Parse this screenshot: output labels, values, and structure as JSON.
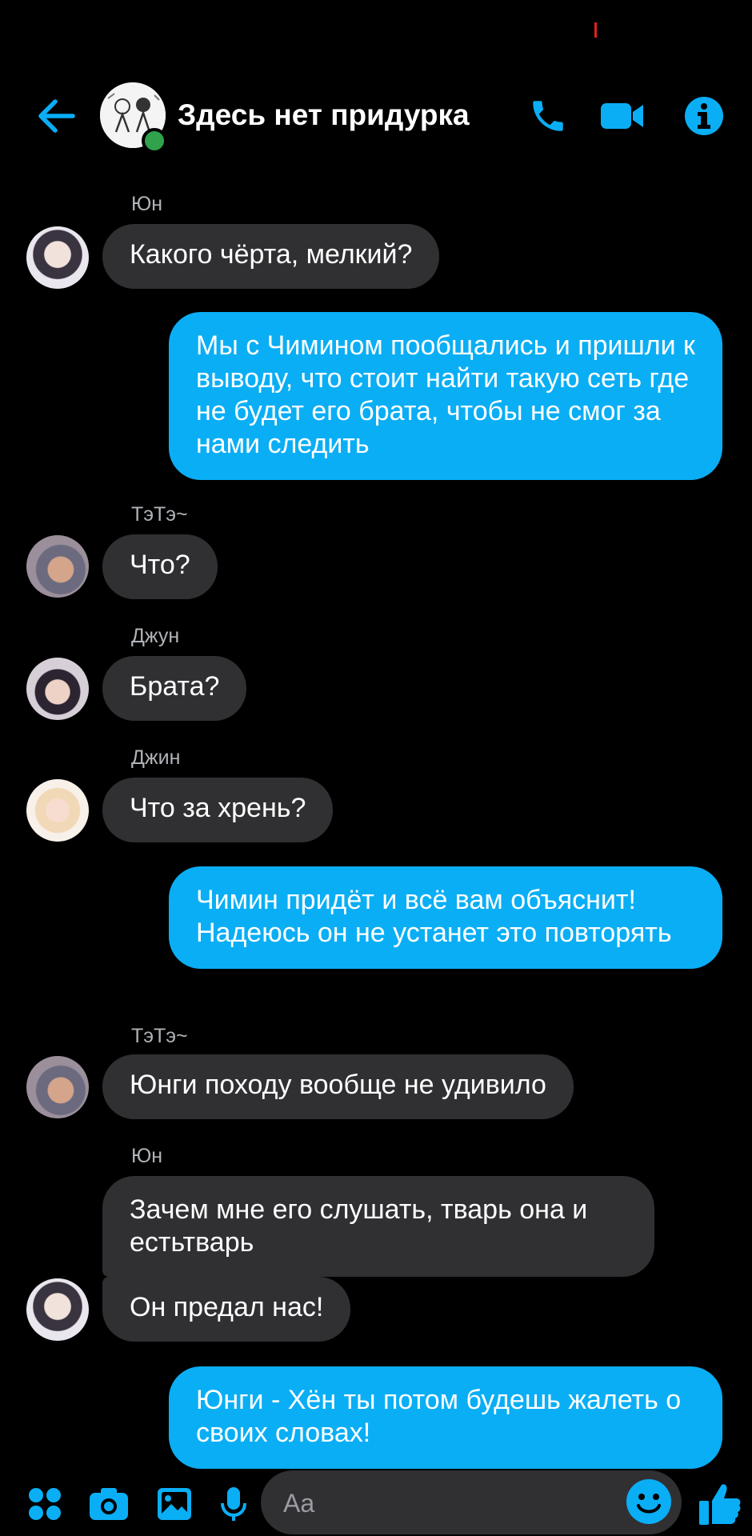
{
  "header": {
    "title": "Здесь нет придурка",
    "accent": "#0aaef5"
  },
  "messages": [
    {
      "sender": "Юн",
      "text": "Какого чёрта, мелкий?"
    },
    {
      "text": "Мы с Чимином пообщались и пришли к выводу, что стоит найти такую сеть где не будет его брата, чтобы не смог  за нами следить"
    },
    {
      "sender": "ТэТэ~",
      "text": "Что?"
    },
    {
      "sender": "Джун",
      "text": "Брата?"
    },
    {
      "sender": "Джин",
      "text": "Что за хрень?"
    },
    {
      "text": "Чимин придёт и всё вам объяснит! Надеюсь он не устанет это повторять"
    },
    {
      "sender": "ТэТэ~",
      "text": "Юнги походу вообще не удивило"
    },
    {
      "sender": "Юн",
      "text": "Зачем мне его слушать, тварь она и естьтварь"
    },
    {
      "text": "Он предал нас!"
    },
    {
      "text": "Юнги - Хён ты потом будешь жалеть о своих словах!"
    }
  ],
  "composer": {
    "placeholder": "Aa"
  },
  "colors": {
    "incoming_bubble": "#303033",
    "outgoing_bubble": "#0aaef5",
    "online": "#31a24c"
  }
}
